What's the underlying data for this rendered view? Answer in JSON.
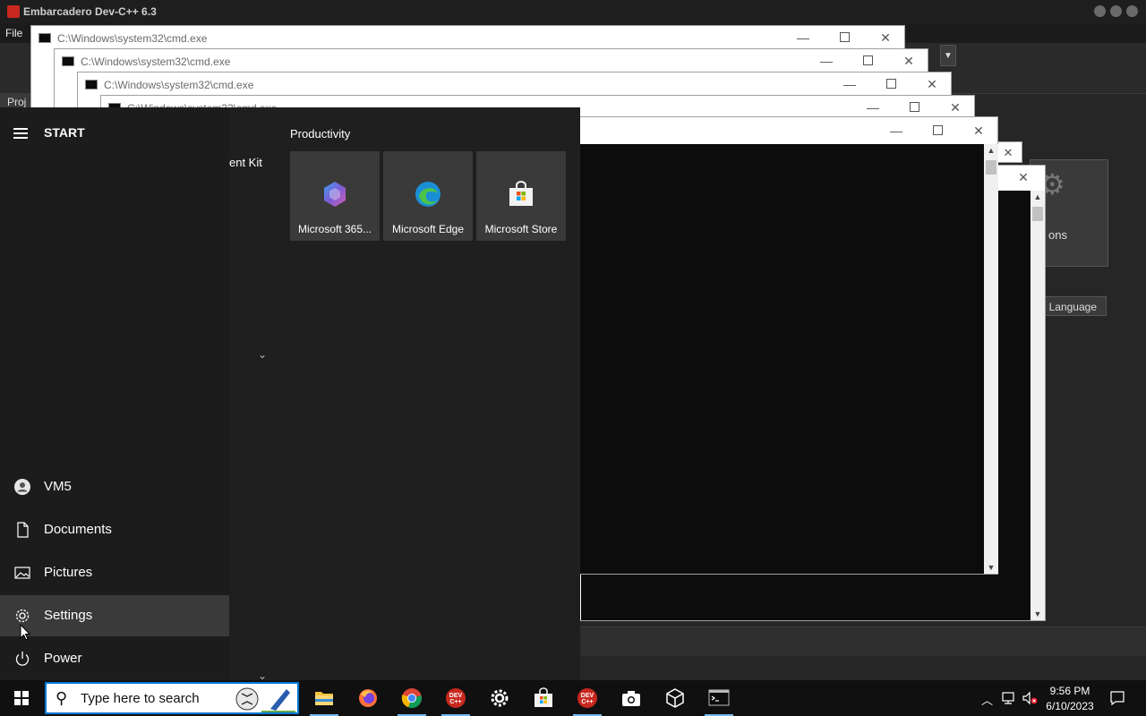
{
  "devcpp": {
    "title": "Embarcadero Dev-C++ 6.3",
    "menu_file": "File",
    "project_tab": "Proj",
    "welcome_options_label": "ons",
    "language_button": "e Language"
  },
  "cmd_windows": [
    {
      "title": "C:\\Windows\\system32\\cmd.exe"
    },
    {
      "title": "C:\\Windows\\system32\\cmd.exe"
    },
    {
      "title": "C:\\Windows\\system32\\cmd.exe"
    },
    {
      "title": "C:\\Windows\\system32\\cmd.exe"
    }
  ],
  "start_menu": {
    "title": "START",
    "applist_fragment": "ent Kit",
    "group_title": "Productivity",
    "tiles": [
      {
        "label": "Microsoft 365...",
        "icon": "microsoft-365-icon"
      },
      {
        "label": "Microsoft Edge",
        "icon": "edge-icon"
      },
      {
        "label": "Microsoft Store",
        "icon": "store-icon"
      }
    ],
    "side_items": [
      {
        "label": "VM5",
        "icon": "user-icon"
      },
      {
        "label": "Documents",
        "icon": "document-icon"
      },
      {
        "label": "Pictures",
        "icon": "pictures-icon"
      },
      {
        "label": "Settings",
        "icon": "gear-icon"
      },
      {
        "label": "Power",
        "icon": "power-icon"
      }
    ]
  },
  "taskbar": {
    "search_placeholder": "Type here to search",
    "apps": [
      {
        "name": "file-explorer"
      },
      {
        "name": "firefox"
      },
      {
        "name": "chrome"
      },
      {
        "name": "dev-cpp"
      },
      {
        "name": "settings"
      },
      {
        "name": "microsoft-store"
      },
      {
        "name": "dev-cpp-2"
      },
      {
        "name": "camera"
      },
      {
        "name": "3d-viewer"
      },
      {
        "name": "command-prompt"
      }
    ],
    "time": "9:56 PM",
    "date": "6/10/2023"
  }
}
